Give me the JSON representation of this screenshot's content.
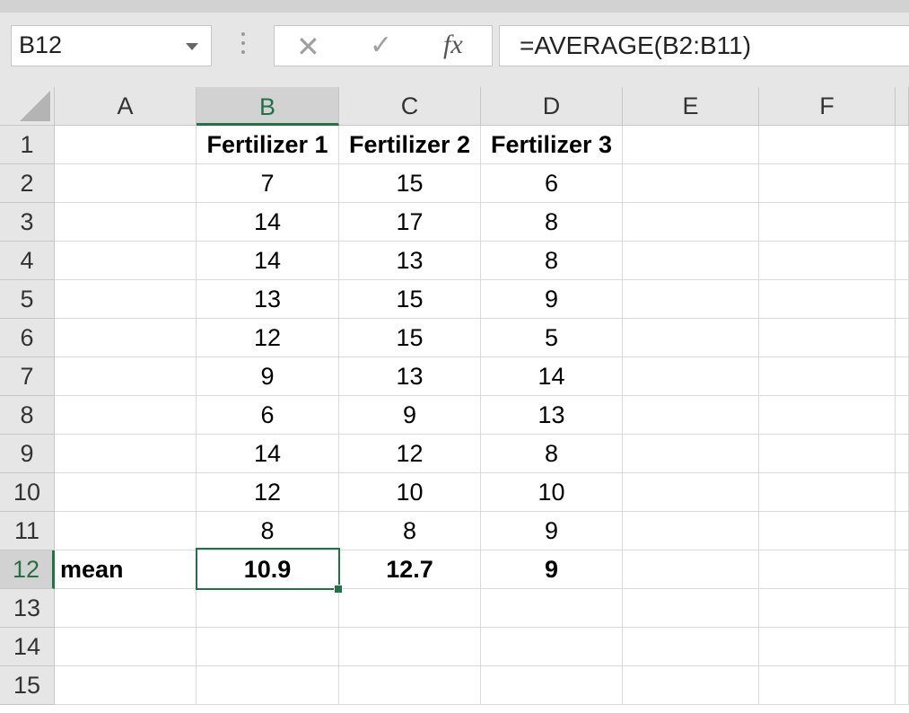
{
  "name_box": {
    "value": "B12"
  },
  "formula_bar": {
    "cancel_icon": "✕",
    "enter_icon": "✓",
    "fx_label": "fx",
    "value": "=AVERAGE(B2:B11)"
  },
  "columns": [
    "A",
    "B",
    "C",
    "D",
    "E",
    "F"
  ],
  "selected_column": "B",
  "rows": [
    "1",
    "2",
    "3",
    "4",
    "5",
    "6",
    "7",
    "8",
    "9",
    "10",
    "11",
    "12",
    "13",
    "14",
    "15"
  ],
  "selected_row": "12",
  "cells": {
    "B1": "Fertilizer 1",
    "C1": "Fertilizer 2",
    "D1": "Fertilizer 3",
    "B2": "7",
    "C2": "15",
    "D2": "6",
    "B3": "14",
    "C3": "17",
    "D3": "8",
    "B4": "14",
    "C4": "13",
    "D4": "8",
    "B5": "13",
    "C5": "15",
    "D5": "9",
    "B6": "12",
    "C6": "15",
    "D6": "5",
    "B7": "9",
    "C7": "13",
    "D7": "14",
    "B8": "6",
    "C8": "9",
    "D8": "13",
    "B9": "14",
    "C9": "12",
    "D9": "8",
    "B10": "12",
    "C10": "10",
    "D10": "10",
    "B11": "8",
    "C11": "8",
    "D11": "9",
    "A12": "mean",
    "B12": "10.9",
    "C12": "12.7",
    "D12": "9"
  },
  "active_cell": "B12",
  "accent_color": "#217346"
}
